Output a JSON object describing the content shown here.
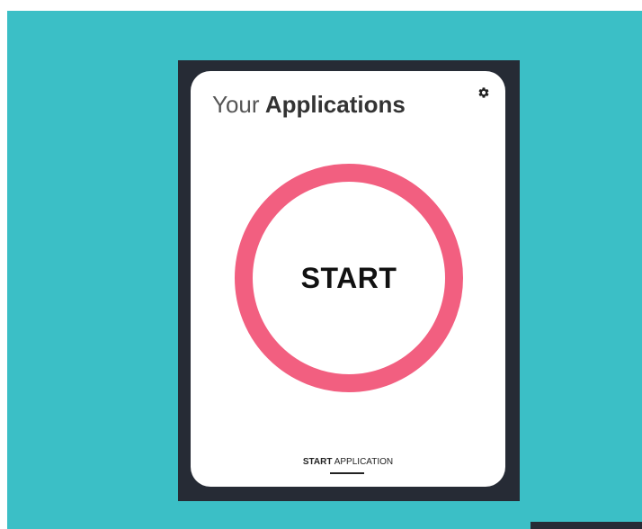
{
  "app": {
    "title_light": "Your",
    "title_bold": "Applications",
    "settings_icon": "gear-icon"
  },
  "start_button": {
    "label": "START",
    "ring_color": "#f25f80"
  },
  "bottom_tab": {
    "bold": "START",
    "normal": "APPLICATION"
  },
  "colors": {
    "background": "#3bbfc6",
    "frame": "#262b35",
    "card": "#ffffff",
    "accent": "#f25f80"
  }
}
